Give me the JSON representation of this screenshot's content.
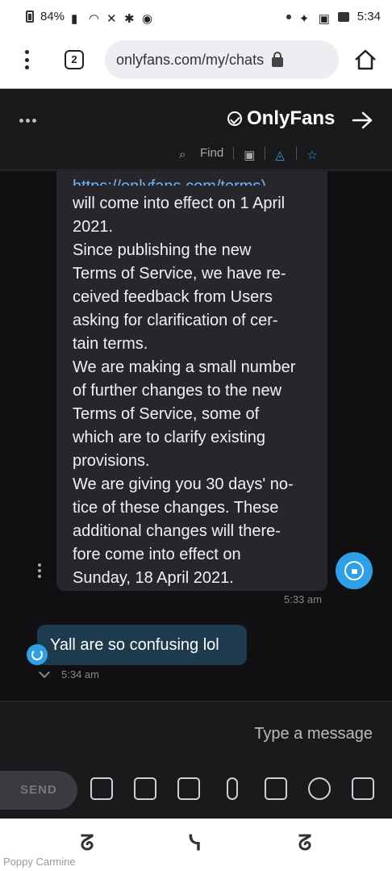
{
  "status_bar": {
    "time": "5:34",
    "battery_text": "84%"
  },
  "browser": {
    "url": "onlyfans.com/my/chats",
    "tab_count": "2"
  },
  "header": {
    "title": "OnlyFans",
    "find_label": "Find"
  },
  "chat": {
    "incoming": {
      "link_fragment": "https://onlyfans.com/terms)",
      "text": "will come into effect on 1 April\n2021.\nSince publishing the new\nTerms of Service, we have re-\nceived feedback from Users\nasking for clarification of cer-\ntain terms.\nWe are making a small number\nof further changes to the new\nTerms of Service, some of\nwhich are to clarify existing\nprovisions.\nWe are giving you 30 days' no-\ntice of these changes. These\nadditional changes will there-\nfore come into effect on\nSunday, 18 April 2021.",
      "time": "5:33 am"
    },
    "outgoing": {
      "text": "Yall are so confusing lol",
      "time": "5:34 am"
    }
  },
  "composer": {
    "placeholder": "Type a message",
    "send_label": "SEND"
  },
  "watermark": "Poppy Carmine"
}
